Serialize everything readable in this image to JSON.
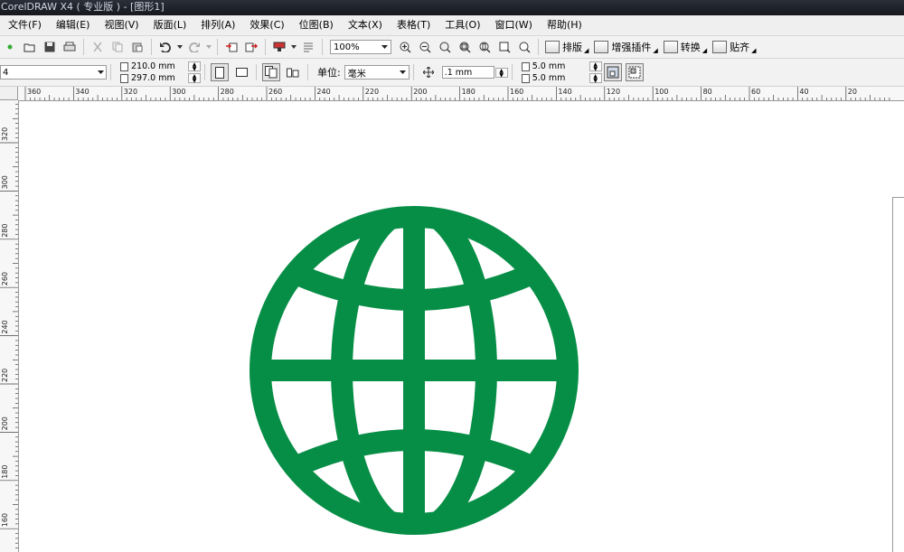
{
  "window": {
    "title": "CorelDRAW X4 ( 专业版 ) - [图形1]"
  },
  "menu": {
    "items": [
      {
        "label": "文件(F)"
      },
      {
        "label": "编辑(E)"
      },
      {
        "label": "视图(V)"
      },
      {
        "label": "版面(L)"
      },
      {
        "label": "排列(A)"
      },
      {
        "label": "效果(C)"
      },
      {
        "label": "位图(B)"
      },
      {
        "label": "文本(X)"
      },
      {
        "label": "表格(T)"
      },
      {
        "label": "工具(O)"
      },
      {
        "label": "窗口(W)"
      },
      {
        "label": "帮助(H)"
      }
    ]
  },
  "toolbar": {
    "zoom": "100%",
    "text_buttons": [
      {
        "label": "排版"
      },
      {
        "label": "增强插件"
      },
      {
        "label": "转换"
      },
      {
        "label": "贴齐"
      }
    ]
  },
  "propbar": {
    "paper_size": "4",
    "width": "210.0 mm",
    "height": "297.0 mm",
    "unit_label": "单位:",
    "unit_value": "毫米",
    "nudge": ".1 mm",
    "dup_x": "5.0 mm",
    "dup_y": "5.0 mm"
  },
  "ruler": {
    "top_labels": [
      "360",
      "340",
      "320",
      "300",
      "280",
      "260",
      "240",
      "220",
      "200",
      "180",
      "160",
      "140",
      "120",
      "100",
      "80",
      "60",
      "40",
      "20"
    ],
    "left_labels": [
      "320",
      "300",
      "280",
      "260",
      "240",
      "220",
      "200",
      "180",
      "160"
    ]
  },
  "canvas": {
    "globe_color": "#078e46",
    "globe_icon": "globe-icon"
  }
}
